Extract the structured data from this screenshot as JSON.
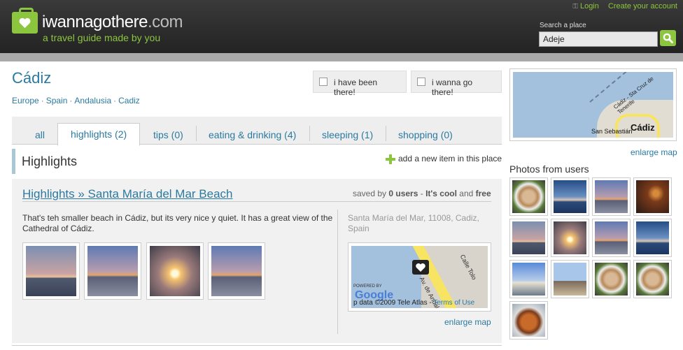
{
  "header": {
    "logo_name": "iwannagothere",
    "logo_domain": ".com",
    "tagline": "a travel guide made by you",
    "login_label": "Login",
    "create_account_label": "Create your account",
    "search_label": "Search a place",
    "search_value": "Adeje",
    "colors": {
      "accent": "#8cc63f",
      "header_bg": "#2b2b2b",
      "link": "#2a7aa0"
    }
  },
  "place": {
    "title": "Cádiz",
    "breadcrumb": [
      "Europe",
      "Spain",
      "Andalusia",
      "Cadiz"
    ],
    "been_there_label": "i have been there!",
    "wanna_go_label": "i wanna go there!"
  },
  "tabs": [
    {
      "label": "all",
      "active": false
    },
    {
      "label": "highlights (2)",
      "active": true
    },
    {
      "label": "tips (0)",
      "active": false
    },
    {
      "label": "eating & drinking (4)",
      "active": false
    },
    {
      "label": "sleeping (1)",
      "active": false
    },
    {
      "label": "shopping (0)",
      "active": false
    }
  ],
  "section": {
    "title": "Highlights",
    "add_item_label": "add a new item in this place"
  },
  "item": {
    "title": "Highlights » Santa María del Mar Beach",
    "saved_prefix": "saved by ",
    "saved_count": "0 users",
    "saved_mid": " - ",
    "saved_opinion": "It's cool",
    "saved_and": " and ",
    "saved_price": "free",
    "description": "That's teh smaller beach in Cádiz, but its very nice y quiet. It has a great view of the Cathedral of Cádiz.",
    "address": "Santa María del Mar, 11008, Cadiz, Spain",
    "map_powered": "POWERED BY",
    "map_logo": "Google",
    "map_copyright": "p data ©2009 Tele Atlas - ",
    "map_terms": "Terms of Use",
    "map_street": "Av. de Andalucía",
    "map_street2": "Calle Tolo",
    "enlarge_label": "enlarge map",
    "photos": [
      {
        "name": "photo-beach-dusk",
        "style": "sky-dusk"
      },
      {
        "name": "photo-beach-palm",
        "style": "sky-sea"
      },
      {
        "name": "photo-sunset-sun",
        "style": "sky-sun"
      },
      {
        "name": "photo-sunset-sea",
        "style": "sky-sea"
      }
    ]
  },
  "sidebar": {
    "map_label": "Cádiz",
    "map_road_label": "Cádiz - Sta Cruz de Tenerife",
    "map_small_label": "San Sebastián",
    "enlarge_label": "enlarge map",
    "photos_title": "Photos from users",
    "photos": [
      {
        "name": "user-photo-food-1",
        "style": "food"
      },
      {
        "name": "user-photo-beach-blue",
        "style": "sky-blue"
      },
      {
        "name": "user-photo-beach-dusk",
        "style": "sky-sea"
      },
      {
        "name": "user-photo-night-bar",
        "style": "night"
      },
      {
        "name": "user-photo-sunset-1",
        "style": "sky-dusk"
      },
      {
        "name": "user-photo-sunset-2",
        "style": "sky-sun"
      },
      {
        "name": "user-photo-sunset-3",
        "style": "sky-sea"
      },
      {
        "name": "user-photo-sunset-4",
        "style": "sky-blue"
      },
      {
        "name": "user-photo-town",
        "style": "town"
      },
      {
        "name": "user-photo-lifeguard",
        "style": "building"
      },
      {
        "name": "user-photo-food-2",
        "style": "food"
      },
      {
        "name": "user-photo-food-3",
        "style": "food"
      },
      {
        "name": "user-photo-paella",
        "style": "paella"
      }
    ]
  }
}
